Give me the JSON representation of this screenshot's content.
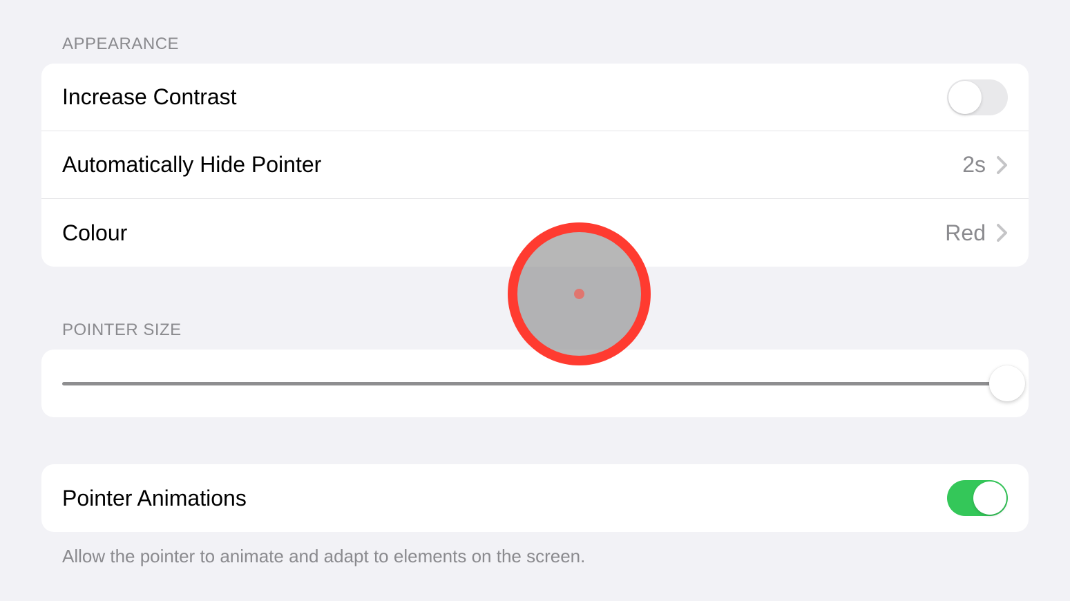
{
  "appearance": {
    "header": "APPEARANCE",
    "increase_contrast": {
      "label": "Increase Contrast",
      "enabled": false
    },
    "auto_hide_pointer": {
      "label": "Automatically Hide Pointer",
      "value": "2s"
    },
    "colour": {
      "label": "Colour",
      "value": "Red"
    }
  },
  "pointer_size": {
    "header": "POINTER SIZE",
    "value": 100
  },
  "pointer_animations": {
    "label": "Pointer Animations",
    "enabled": true,
    "footer": "Allow the pointer to animate and adapt to elements on the screen."
  }
}
